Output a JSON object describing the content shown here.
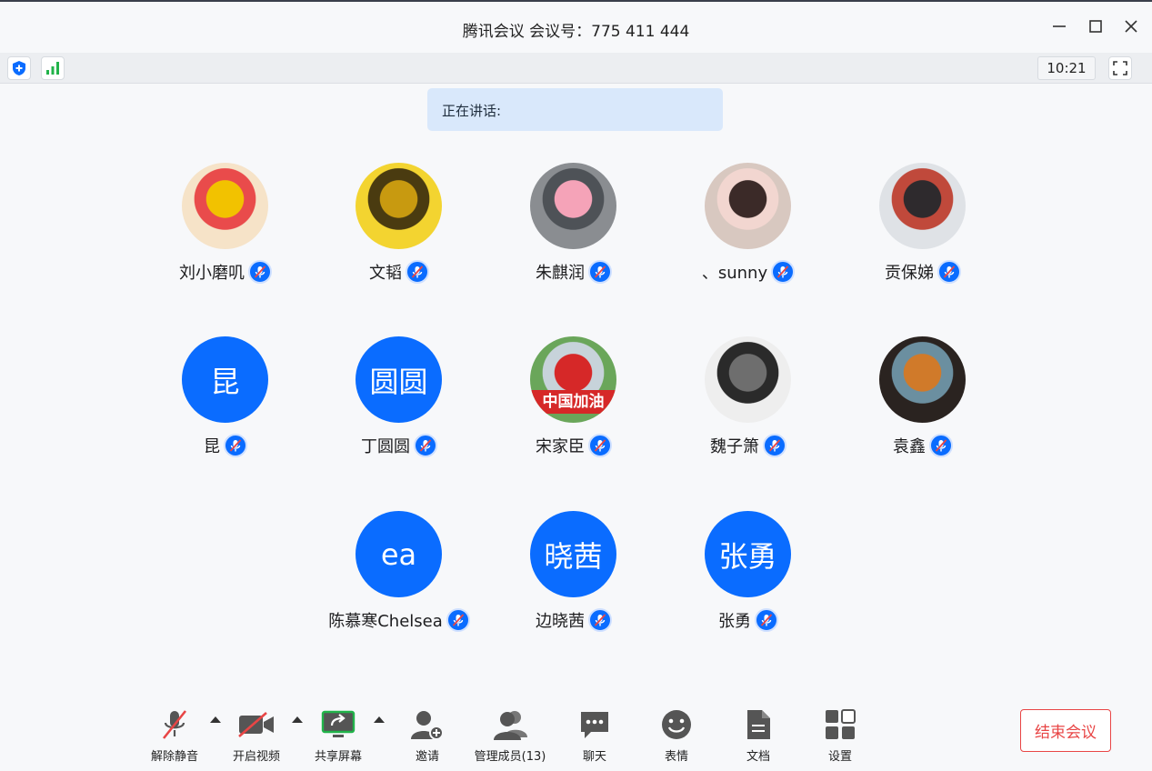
{
  "window": {
    "title": "腾讯会议 会议号：775 411 444"
  },
  "topbar": {
    "time": "10:21"
  },
  "speaking": {
    "label": "正在讲话:"
  },
  "participants": [
    {
      "name": "刘小磨叽",
      "avatar_type": "photo",
      "avatar_text": "",
      "avatar_colors": [
        "#f6e3c8",
        "#f2c200",
        "#e94b4b"
      ]
    },
    {
      "name": "文韬",
      "avatar_type": "photo",
      "avatar_text": "",
      "avatar_colors": [
        "#f3d430",
        "#c89a10",
        "#4a3b10"
      ]
    },
    {
      "name": "朱麒润",
      "avatar_type": "photo",
      "avatar_text": "",
      "avatar_colors": [
        "#8a8d91",
        "#f5a3b8",
        "#4e5257"
      ]
    },
    {
      "name": "、sunny",
      "avatar_type": "photo",
      "avatar_text": "",
      "avatar_colors": [
        "#d8c8c0",
        "#3b2a28",
        "#f2d6d0"
      ]
    },
    {
      "name": "贡保娣",
      "avatar_type": "photo",
      "avatar_text": "",
      "avatar_colors": [
        "#dfe2e6",
        "#2e2a2d",
        "#c0493b"
      ]
    },
    {
      "name": "昆",
      "avatar_type": "text",
      "avatar_text": "昆",
      "avatar_colors": [
        "#0a6cff"
      ]
    },
    {
      "name": "丁圆圆",
      "avatar_type": "text",
      "avatar_text": "圆圆",
      "avatar_colors": [
        "#0a6cff"
      ]
    },
    {
      "name": "宋家臣",
      "avatar_type": "photo",
      "avatar_text": "中国加油",
      "avatar_colors": [
        "#6aa65a",
        "#d62828",
        "#c7d3da"
      ]
    },
    {
      "name": "魏子箫",
      "avatar_type": "photo",
      "avatar_text": "",
      "avatar_colors": [
        "#eeeeee",
        "#6e6e6e",
        "#2a2a2a"
      ]
    },
    {
      "name": "袁鑫",
      "avatar_type": "photo",
      "avatar_text": "",
      "avatar_colors": [
        "#2a2320",
        "#d07a2a",
        "#6b8fa0"
      ]
    },
    {
      "name": "陈慕寒Chelsea",
      "avatar_type": "text",
      "avatar_text": "ea",
      "avatar_colors": [
        "#0a6cff"
      ]
    },
    {
      "name": "边晓茜",
      "avatar_type": "text",
      "avatar_text": "晓茜",
      "avatar_colors": [
        "#0a6cff"
      ]
    },
    {
      "name": "张勇",
      "avatar_type": "text",
      "avatar_text": "张勇",
      "avatar_colors": [
        "#0a6cff"
      ]
    }
  ],
  "toolbar": {
    "unmute": "解除静音",
    "start_video": "开启视频",
    "share_screen": "共享屏幕",
    "invite": "邀请",
    "manage_members": "管理成员(13)",
    "chat": "聊天",
    "emoji": "表情",
    "docs": "文档",
    "settings": "设置",
    "end_meeting": "结束会议"
  },
  "colors": {
    "accent": "#0a6cff",
    "danger": "#e84545",
    "share_green": "#21b34a"
  }
}
